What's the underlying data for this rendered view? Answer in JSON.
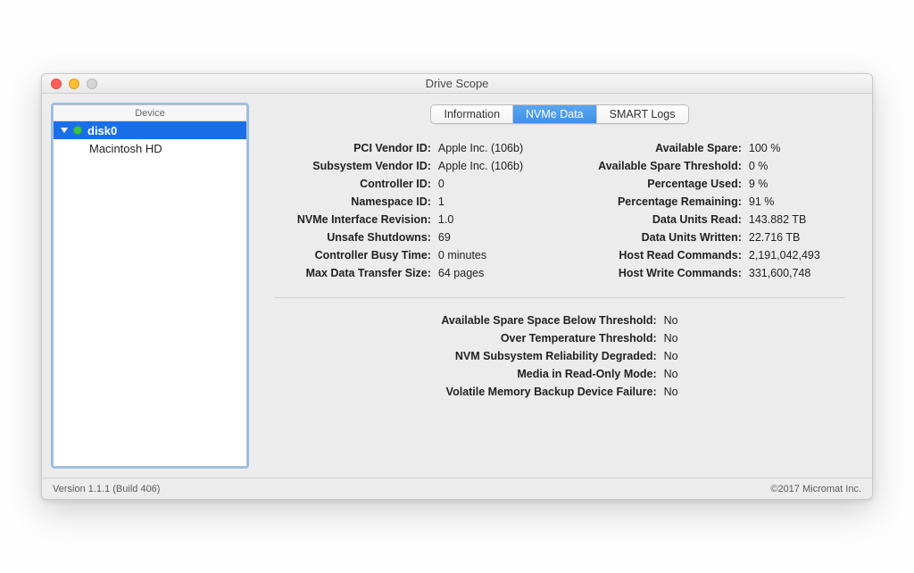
{
  "window": {
    "title": "Drive Scope"
  },
  "sidebar": {
    "header": "Device",
    "disk_label": "disk0",
    "disk_child": "Macintosh HD"
  },
  "tabs": {
    "information": "Information",
    "nvme_data": "NVMe Data",
    "smart_logs": "SMART Logs"
  },
  "left": [
    {
      "label": "PCI Vendor ID:",
      "value": "Apple Inc. (106b)"
    },
    {
      "label": "Subsystem Vendor ID:",
      "value": "Apple Inc. (106b)"
    },
    {
      "label": "Controller ID:",
      "value": "0"
    },
    {
      "label": "Namespace ID:",
      "value": "1"
    },
    {
      "label": "NVMe Interface Revision:",
      "value": "1.0"
    },
    {
      "label": "Unsafe Shutdowns:",
      "value": "69"
    },
    {
      "label": "Controller Busy Time:",
      "value": "0 minutes"
    },
    {
      "label": "Max Data Transfer Size:",
      "value": "64 pages"
    }
  ],
  "right": [
    {
      "label": "Available Spare:",
      "value": "100 %"
    },
    {
      "label": "Available Spare Threshold:",
      "value": "0 %"
    },
    {
      "label": "Percentage Used:",
      "value": "9 %"
    },
    {
      "label": "Percentage Remaining:",
      "value": "91 %"
    },
    {
      "label": "Data Units Read:",
      "value": "143.882 TB"
    },
    {
      "label": "Data Units Written:",
      "value": "22.716 TB"
    },
    {
      "label": "Host Read Commands:",
      "value": "2,191,042,493"
    },
    {
      "label": "Host Write Commands:",
      "value": "331,600,748"
    }
  ],
  "status": [
    {
      "label": "Available Spare Space Below Threshold:",
      "value": "No"
    },
    {
      "label": "Over Temperature Threshold:",
      "value": "No"
    },
    {
      "label": "NVM Subsystem Reliability Degraded:",
      "value": "No"
    },
    {
      "label": "Media in Read-Only Mode:",
      "value": "No"
    },
    {
      "label": "Volatile Memory Backup Device Failure:",
      "value": "No"
    }
  ],
  "footer": {
    "version": "Version 1.1.1 (Build 406)",
    "copyright": "©2017 Micromat Inc."
  }
}
